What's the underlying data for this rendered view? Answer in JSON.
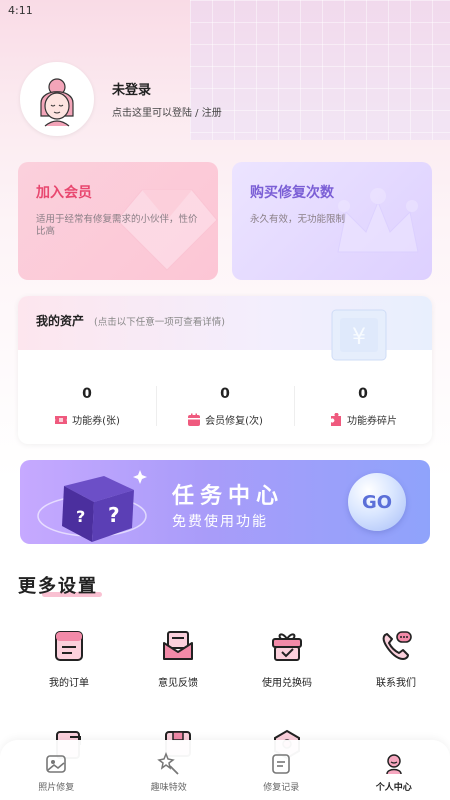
{
  "status_bar": {
    "time": "4:11"
  },
  "profile": {
    "name": "未登录",
    "hint": "点击这里可以登陆 / 注册"
  },
  "cards": {
    "vip": {
      "title": "加入会员",
      "desc": "适用于经常有修复需求的小伙伴，性价比高"
    },
    "buy": {
      "title": "购买修复次数",
      "desc": "永久有效，无功能限制"
    }
  },
  "assets": {
    "title": "我的资产",
    "subtitle": "(点击以下任意一项可查看详情)",
    "items": [
      {
        "value": "0",
        "label": "功能券(张)"
      },
      {
        "value": "0",
        "label": "会员修复(次)"
      },
      {
        "value": "0",
        "label": "功能券碎片"
      }
    ]
  },
  "task": {
    "title": "任务中心",
    "subtitle": "免费使用功能",
    "go_label": "GO"
  },
  "more": {
    "title": "更多设置",
    "items": [
      {
        "label": "我的订单",
        "icon": "order-icon"
      },
      {
        "label": "意见反馈",
        "icon": "feedback-icon"
      },
      {
        "label": "使用兑换码",
        "icon": "gift-icon"
      },
      {
        "label": "联系我们",
        "icon": "phone-icon"
      }
    ]
  },
  "nav": {
    "items": [
      {
        "label": "照片修复",
        "icon": "photo-icon"
      },
      {
        "label": "趣味特效",
        "icon": "magic-icon"
      },
      {
        "label": "修复记录",
        "icon": "record-icon"
      },
      {
        "label": "个人中心",
        "icon": "user-icon",
        "active": true
      }
    ]
  },
  "colors": {
    "vip_accent": "#e8476f",
    "buy_accent": "#7b5fd6",
    "icon_pink": "#f28aa8"
  }
}
